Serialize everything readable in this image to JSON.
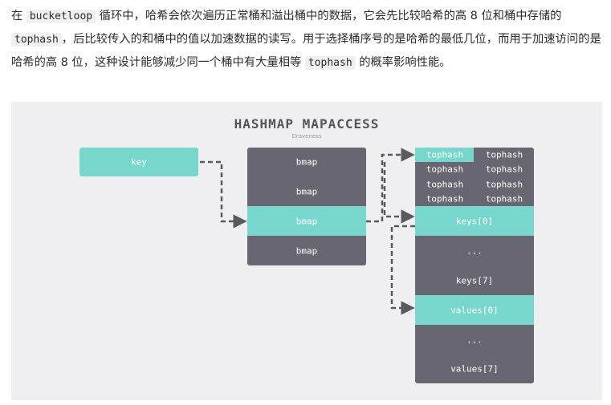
{
  "paragraph": {
    "t1": "在 ",
    "c1": "bucketloop",
    "t2": " 循环中，哈希会依次遍历正常桶和溢出桶中的数据，它会先比较哈希的高 8 位和桶中存储的 ",
    "c2": "tophash",
    "t3": "，后比较传入的和桶中的值以加速数据的读写。用于选择桶序号的是哈希的最低几位，而用于加速访问的是哈希的高 8 位，这种设计能够减少同一个桶中有大量相等 ",
    "c3": "tophash",
    "t4": " 的概率影响性能。"
  },
  "figure": {
    "title": "HASHMAP MAPACCESS",
    "subtitle": "Draveness",
    "key_label": "key",
    "buckets": [
      "bmap",
      "bmap",
      "bmap",
      "bmap"
    ],
    "tophash_grid": [
      [
        "tophash",
        "tophash"
      ],
      [
        "tophash",
        "tophash"
      ],
      [
        "tophash",
        "tophash"
      ],
      [
        "tophash",
        "tophash"
      ]
    ],
    "slots": [
      "keys[0]",
      "...",
      "keys[7]",
      "values[0]",
      "...",
      "values[7]"
    ],
    "colors": {
      "accent": "#78d7cc",
      "box": "#686670",
      "arrow": "#5a5960",
      "background": "#efeff1"
    }
  }
}
